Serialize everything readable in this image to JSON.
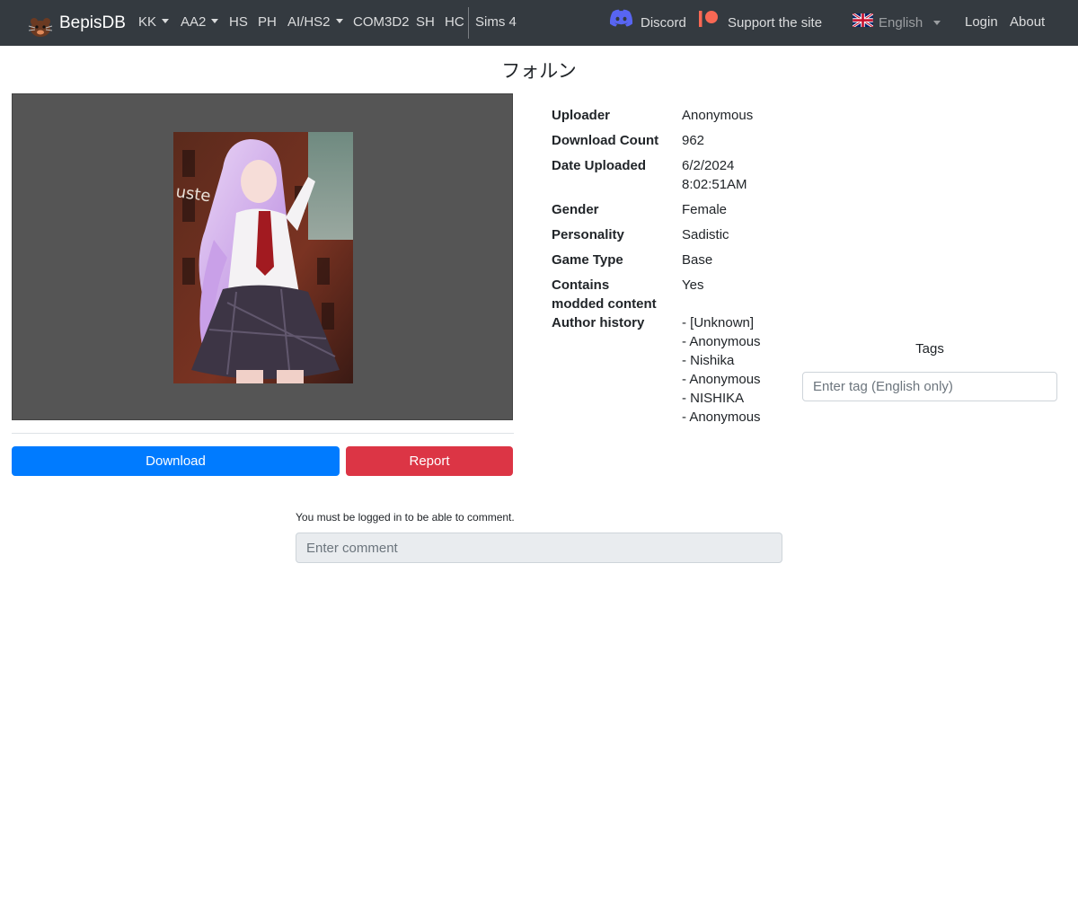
{
  "nav": {
    "brand": "BepisDB",
    "items": [
      {
        "label": "KK",
        "dropdown": true
      },
      {
        "label": "AA2",
        "dropdown": true
      },
      {
        "label": "HS",
        "dropdown": false
      },
      {
        "label": "PH",
        "dropdown": false
      },
      {
        "label": "AI/HS2",
        "dropdown": true
      },
      {
        "label": "COM3D2",
        "dropdown": false
      },
      {
        "label": "SH",
        "dropdown": false
      },
      {
        "label": "HC",
        "dropdown": false
      },
      {
        "label": "Sims 4",
        "dropdown": false
      }
    ],
    "discord": "Discord",
    "support": "Support the site",
    "language": "English",
    "login": "Login",
    "about": "About"
  },
  "card": {
    "title": "フォルン",
    "buttons": {
      "download": "Download",
      "report": "Report"
    }
  },
  "details": {
    "uploader": {
      "label": "Uploader",
      "value": "Anonymous"
    },
    "download_count": {
      "label": "Download Count",
      "value": "962"
    },
    "date_uploaded": {
      "label": "Date Uploaded",
      "value_line1": "6/2/2024",
      "value_line2": "8:02:51AM"
    },
    "gender": {
      "label": "Gender",
      "value": "Female"
    },
    "personality": {
      "label": "Personality",
      "value": "Sadistic"
    },
    "game_type": {
      "label": "Game Type",
      "value": "Base"
    },
    "modded": {
      "label_line1": "Contains",
      "label_line2": "modded content",
      "value": "Yes"
    },
    "author_history": {
      "label": "Author history",
      "entries": [
        "- [Unknown]",
        "- Anonymous",
        "- Nishika",
        "- Anonymous",
        "- NISHIKA",
        "- Anonymous"
      ]
    }
  },
  "tags": {
    "title": "Tags",
    "placeholder": "Enter tag (English only)"
  },
  "comments": {
    "note": "You must be logged in to be able to comment.",
    "placeholder": "Enter comment"
  },
  "colors": {
    "navbar": "#343a40",
    "download_button": "#007bff",
    "report_button": "#dc3545",
    "discord": "#5865f2",
    "patreon": "#f96854"
  }
}
